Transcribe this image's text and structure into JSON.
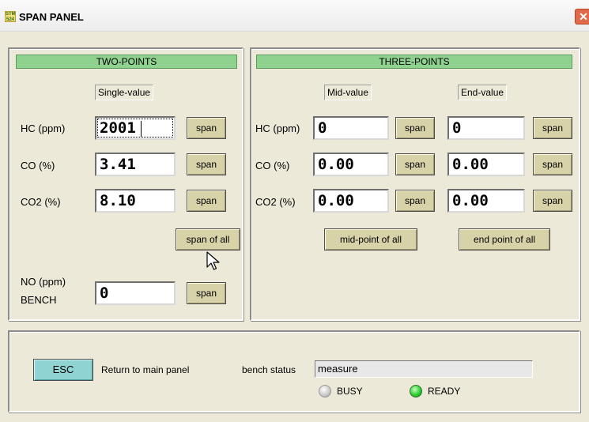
{
  "window": {
    "title": "SPAN PANEL",
    "app_icon_text": "STM 524"
  },
  "two_points": {
    "header": "TWO-POINTS",
    "single_value_label": "Single-value",
    "rows": [
      {
        "label": "HC (ppm)",
        "value": "2001",
        "button": "span"
      },
      {
        "label": "CO (%)",
        "value": "3.41",
        "button": "span"
      },
      {
        "label": "CO2  (%)",
        "value": "8.10",
        "button": "span"
      }
    ],
    "span_all_button": "span of all",
    "no_label_line1": "NO (ppm)",
    "no_label_line2": "BENCH",
    "no_value": "0",
    "no_button": "span"
  },
  "three_points": {
    "header": "THREE-POINTS",
    "mid_value_label": "Mid-value",
    "end_value_label": "End-value",
    "rows": [
      {
        "label": "HC (ppm)",
        "mid": "0",
        "mid_button": "span",
        "end": "0",
        "end_button": "span"
      },
      {
        "label": "CO (%)",
        "mid": "0.00",
        "mid_button": "span",
        "end": "0.00",
        "end_button": "span"
      },
      {
        "label": "CO2  (%)",
        "mid": "0.00",
        "mid_button": "span",
        "end": "0.00",
        "end_button": "span"
      }
    ],
    "mid_all_button": "mid-point of all",
    "end_all_button": "end point of all"
  },
  "bottom": {
    "esc_button": "ESC",
    "esc_text": "Return to main panel",
    "bench_status_label": "bench status",
    "bench_status_value": "measure",
    "busy_label": "BUSY",
    "ready_label": "READY"
  },
  "colors": {
    "panel_header": "#8fd18f",
    "span_button": "#d8d2a8",
    "esc_button": "#8fd3d3",
    "ready_led": "#2fcf2f",
    "busy_led": "#c8c8c8"
  }
}
